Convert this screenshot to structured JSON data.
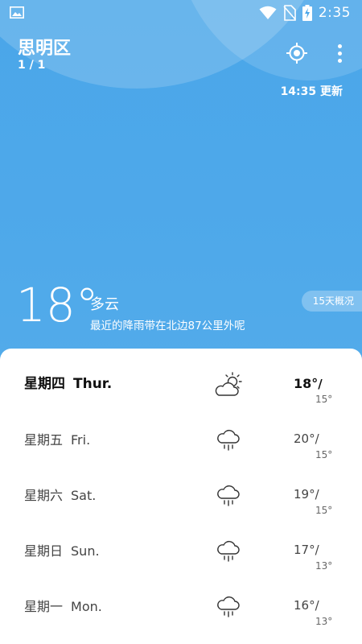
{
  "status_bar": {
    "time": "2:35",
    "icons": [
      "gallery-icon",
      "wifi-icon",
      "no-sim-icon",
      "battery-charging-icon"
    ]
  },
  "header": {
    "city": "思明区",
    "page_indicator": "1 / 1",
    "updated": "14:35 更新",
    "icons": [
      "locate-icon",
      "more-vert-icon"
    ]
  },
  "current": {
    "temperature": "18°",
    "condition": "多云",
    "description": "最近的降雨带在北边87公里外呢",
    "forecast_button": "15天概况"
  },
  "forecast": [
    {
      "day_cn": "星期四",
      "day_en": "Thur.",
      "icon": "partly-cloudy-icon",
      "high": "18°",
      "low": "15°",
      "today": true
    },
    {
      "day_cn": "星期五",
      "day_en": "Fri.",
      "icon": "rain-icon",
      "high": "20°",
      "low": "15°",
      "today": false
    },
    {
      "day_cn": "星期六",
      "day_en": "Sat.",
      "icon": "rain-icon",
      "high": "19°",
      "low": "15°",
      "today": false
    },
    {
      "day_cn": "星期日",
      "day_en": "Sun.",
      "icon": "rain-icon",
      "high": "17°",
      "low": "13°",
      "today": false
    },
    {
      "day_cn": "星期一",
      "day_en": "Mon.",
      "icon": "rain-icon",
      "high": "16°",
      "low": "13°",
      "today": false
    }
  ],
  "colors": {
    "sky": "#4fa9ea",
    "card": "#ffffff",
    "text_dark": "#111111"
  }
}
